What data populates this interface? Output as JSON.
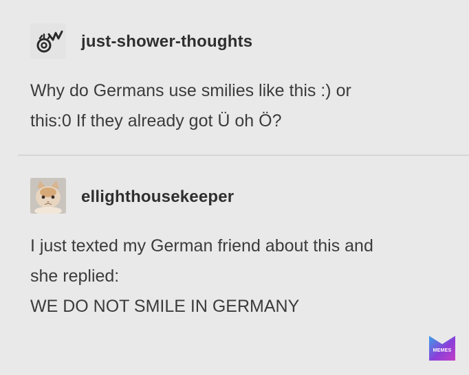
{
  "posts": [
    {
      "username": "just-shower-thoughts",
      "avatar_icon": "lightbulb-head-icon",
      "body_lines": [
        "Why do Germans use smilies like this :) or",
        "this:0 If they already got Ü oh Ö?"
      ]
    },
    {
      "username": "ellighthousekeeper",
      "avatar_icon": "cat-avatar-icon",
      "body_lines": [
        "I just texted my German friend about this and",
        "she replied:",
        "WE DO NOT SMILE IN GERMANY"
      ]
    }
  ],
  "watermark": {
    "label": "MEMES",
    "icon": "memes-logo-icon",
    "colors": [
      "#3aa0e8",
      "#8b3fd9",
      "#c23fc4"
    ]
  }
}
